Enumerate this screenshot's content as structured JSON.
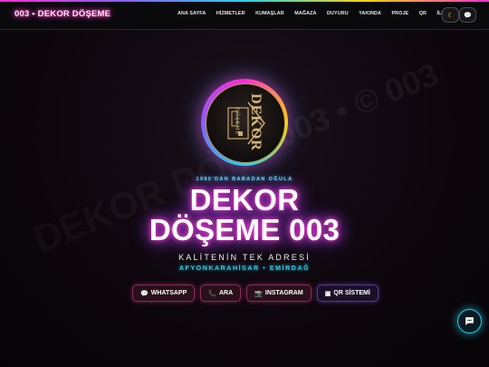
{
  "header": {
    "brand": "003 • DEKOR DÖŞEME",
    "nav": [
      "ANA SAYFA",
      "HİZMETLER",
      "KUMAŞLAR",
      "MAĞAZA",
      "DUYURU",
      "YAKINDA",
      "PROJE",
      "QR",
      "İLETİŞİM"
    ],
    "icon_buttons": [
      "theme-icon",
      "chat-icon"
    ]
  },
  "watermark": {
    "left_text": "DEKOR DÖŞ",
    "right_text": "003 • © 003"
  },
  "logo": {
    "text_line1": "DEKOR",
    "text_line2": "DÖŞEME",
    "icon": "house-sofa-icon"
  },
  "hero": {
    "eyebrow": "1990'DAN BABADAN OĞULA",
    "title_line1": "DEKOR",
    "title_line2": "DÖŞEME 003",
    "subtitle": "KALİTENİN TEK ADRESİ",
    "location": "AFYONKARAHİSAR • EMİRDAĞ"
  },
  "actions": [
    {
      "label": "WHATSAPP",
      "icon": "💬"
    },
    {
      "label": "ARA",
      "icon": "📞"
    },
    {
      "label": "INSTAGRAM",
      "icon": "📸"
    },
    {
      "label": "QR SİSTEMİ",
      "icon": "▣"
    }
  ],
  "colors": {
    "neon_pink": "#ff3ec9",
    "neon_cyan": "#22d3ee",
    "neon_purple": "#8b5cf6",
    "gold": "#b89a5c"
  }
}
